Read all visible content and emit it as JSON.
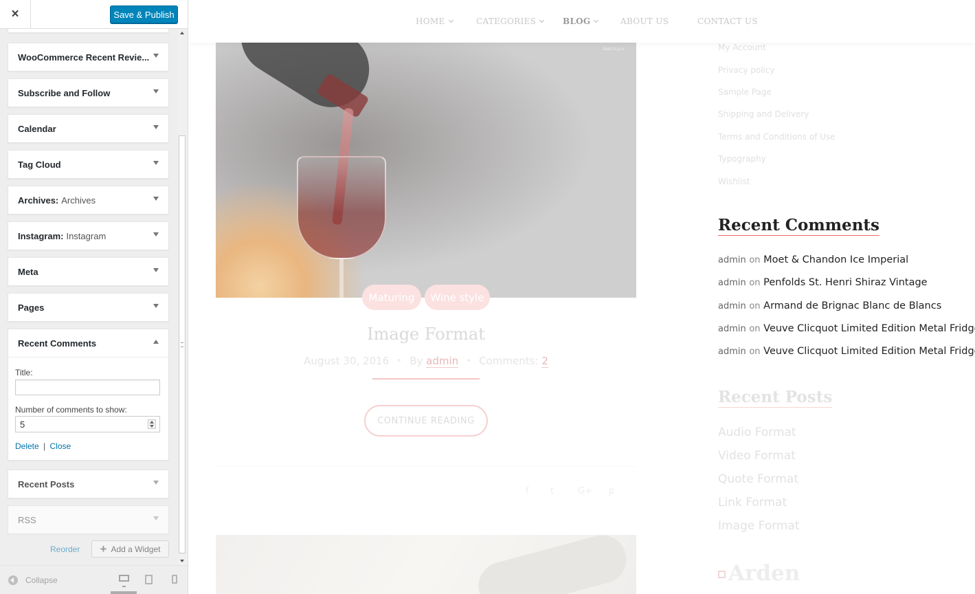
{
  "header": {
    "close_label": "×",
    "save_label": "Save & Publish"
  },
  "widgets": [
    {
      "title": "WooCommerce Recent Revie...",
      "subtitle": ""
    },
    {
      "title": "Subscribe and Follow",
      "subtitle": ""
    },
    {
      "title": "Calendar",
      "subtitle": ""
    },
    {
      "title": "Tag Cloud",
      "subtitle": ""
    },
    {
      "title": "Archives:",
      "subtitle": "Archives"
    },
    {
      "title": "Instagram:",
      "subtitle": "Instagram"
    },
    {
      "title": "Meta",
      "subtitle": ""
    },
    {
      "title": "Pages",
      "subtitle": ""
    }
  ],
  "open_widget": {
    "title": "Recent Comments",
    "title_label": "Title:",
    "title_value": "",
    "count_label": "Number of comments to show:",
    "count_value": "5",
    "delete_label": "Delete",
    "separator": "|",
    "close_label": "Close"
  },
  "faded_widgets": [
    {
      "title": "Recent Posts"
    },
    {
      "title": "RSS"
    }
  ],
  "panel_actions": {
    "reorder_label": "Reorder",
    "add_widget_label": "Add a Widget"
  },
  "footer": {
    "collapse_label": "Collapse",
    "active_device": "desktop"
  },
  "preview": {
    "nav": [
      {
        "label": "HOME",
        "has_dropdown": true
      },
      {
        "label": "CATEGORIES",
        "has_dropdown": true
      },
      {
        "label": "BLOG",
        "has_dropdown": true
      },
      {
        "label": "ABOUT US",
        "has_dropdown": false
      },
      {
        "label": "CONTACT US",
        "has_dropdown": false
      }
    ],
    "hero_badge": "sketch.pro",
    "tags": [
      "Maturing",
      "Wine style"
    ],
    "post_title": "Image Format",
    "post_date": "August 30, 2016",
    "by_label": "By",
    "author": "admin",
    "comments_label": "Comments:",
    "comments_count": "2",
    "continue_label": "CONTINUE READING",
    "share_icons": [
      "f",
      "t",
      "G+",
      "p"
    ],
    "pages": [
      "My Account",
      "Privacy policy",
      "Sample Page",
      "Shipping and Delivery",
      "Terms and Conditions of Use",
      "Typography",
      "Wishlist"
    ],
    "recent_comments_title": "Recent Comments",
    "recent_comments": [
      {
        "author": "admin",
        "on": "on",
        "post": "Moet & Chandon Ice Imperial"
      },
      {
        "author": "admin",
        "on": "on",
        "post": "Penfolds St. Henri Shiraz Vintage"
      },
      {
        "author": "admin",
        "on": "on",
        "post": "Armand de Brignac Blanc de Blancs"
      },
      {
        "author": "admin",
        "on": "on",
        "post": "Veuve Clicquot Limited Edition Metal Fridge"
      },
      {
        "author": "admin",
        "on": "on",
        "post": "Veuve Clicquot Limited Edition Metal Fridge"
      }
    ],
    "recent_posts_title": "Recent Posts",
    "recent_posts": [
      "Audio Format",
      "Video Format",
      "Quote Format",
      "Link Format",
      "Image Format"
    ],
    "brand": "Arden"
  },
  "colors": {
    "primary_button": "#0085ba",
    "link": "#0073aa",
    "accent": "#e66666"
  }
}
